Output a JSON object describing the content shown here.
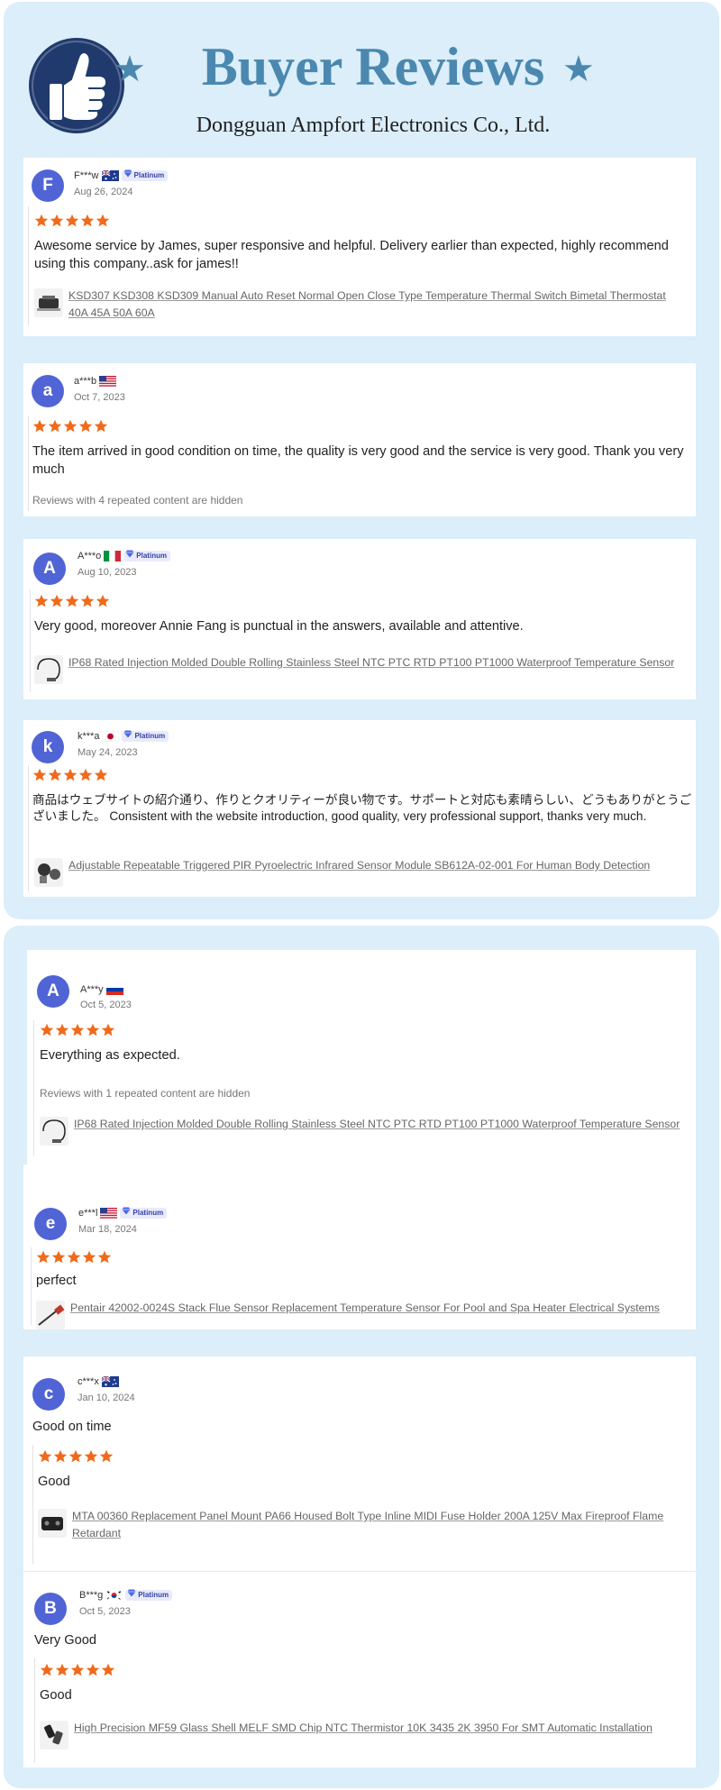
{
  "header": {
    "title": "Buyer Reviews",
    "star_glyph": "★",
    "company": "Dongguan Ampfort Electronics Co., Ltd."
  },
  "theme": {
    "panel_bg": "#dbeef9",
    "title_color": "#4b88b0",
    "avatar_color": "#5064d6",
    "star_color": "#f06a1a"
  },
  "reviews": [
    {
      "initial": "F",
      "user": "F***w",
      "flag": "australia",
      "platinum": true,
      "date": "Aug 26, 2024",
      "rating": 5,
      "text": "Awesome service by James, super responsive and helpful. Delivery earlier than expected, highly recommend using this company..ask for james!!",
      "product": "KSD307 KSD308 KSD309 Manual Auto Reset Normal Open Close Type Temperature Thermal Switch Bimetal Thermostat 40A 45A 50A 60A",
      "product_icon": "thermostat-icon"
    },
    {
      "initial": "a",
      "user": "a***b",
      "flag": "usa",
      "platinum": false,
      "date": "Oct 7, 2023",
      "rating": 5,
      "text": "The item arrived in good condition on time, the quality is very good and the service is very good. Thank you very much",
      "note": "Reviews with 4 repeated content are hidden"
    },
    {
      "initial": "A",
      "user": "A***o",
      "flag": "italy",
      "platinum": true,
      "date": "Aug 10, 2023",
      "rating": 5,
      "text": "Very good, moreover Annie Fang is punctual in the answers, available and attentive.",
      "product": "IP68 Rated Injection Molded Double Rolling Stainless Steel NTC PTC RTD PT100 PT1000 Waterproof Temperature Sensor",
      "product_icon": "cable-sensor-icon"
    },
    {
      "initial": "k",
      "user": "k***a",
      "flag": "japan",
      "platinum": true,
      "date": "May 24, 2023",
      "rating": 5,
      "text": "商品はウェブサイトの紹介通り、作りとクオリティーが良い物です。サポートと対応も素晴らしい、どうもありがとうございました。 Consistent with the website introduction, good quality, very professional support, thanks very much.",
      "product": "Adjustable Repeatable Triggered PIR Pyroelectric Infrared Sensor Module SB612A-02-001 For Human Body Detection",
      "product_icon": "pir-module-icon"
    },
    {
      "initial": "A",
      "user": "A***y",
      "flag": "russia",
      "platinum": false,
      "date": "Oct 5, 2023",
      "rating": 5,
      "text": "Everything as expected.",
      "note": "Reviews with 1 repeated content are hidden",
      "product": "IP68 Rated Injection Molded Double Rolling Stainless Steel NTC PTC RTD PT100 PT1000 Waterproof Temperature Sensor",
      "product_icon": "cable-sensor-icon"
    },
    {
      "initial": "e",
      "user": "e***l",
      "flag": "usa",
      "platinum": true,
      "date": "Mar 18, 2024",
      "rating": 5,
      "text": "perfect",
      "product": "Pentair 42002-0024S Stack Flue Sensor Replacement Temperature Sensor For Pool and Spa Heater Electrical Systems",
      "product_icon": "probe-icon"
    },
    {
      "initial": "c",
      "user": "c***x",
      "flag": "australia",
      "platinum": false,
      "date": "Jan 10, 2024",
      "rating": 5,
      "headline": "Good on time",
      "text": "Good",
      "product": "MTA 00360 Replacement Panel Mount PA66 Housed Bolt Type Inline MIDI Fuse Holder 200A 125V Max Fireproof Flame Retardant",
      "product_icon": "fuse-holder-icon"
    },
    {
      "initial": "B",
      "user": "B***g",
      "flag": "korea",
      "platinum": true,
      "date": "Oct 5, 2023",
      "rating": 5,
      "headline": "Very Good",
      "text": "Good",
      "product": "High Precision MF59 Glass Shell MELF SMD Chip NTC Thermistor 10K 3435 2K 3950 For SMT Automatic Installation",
      "product_icon": "thermistor-icon"
    }
  ],
  "badge_label": "Platinum"
}
